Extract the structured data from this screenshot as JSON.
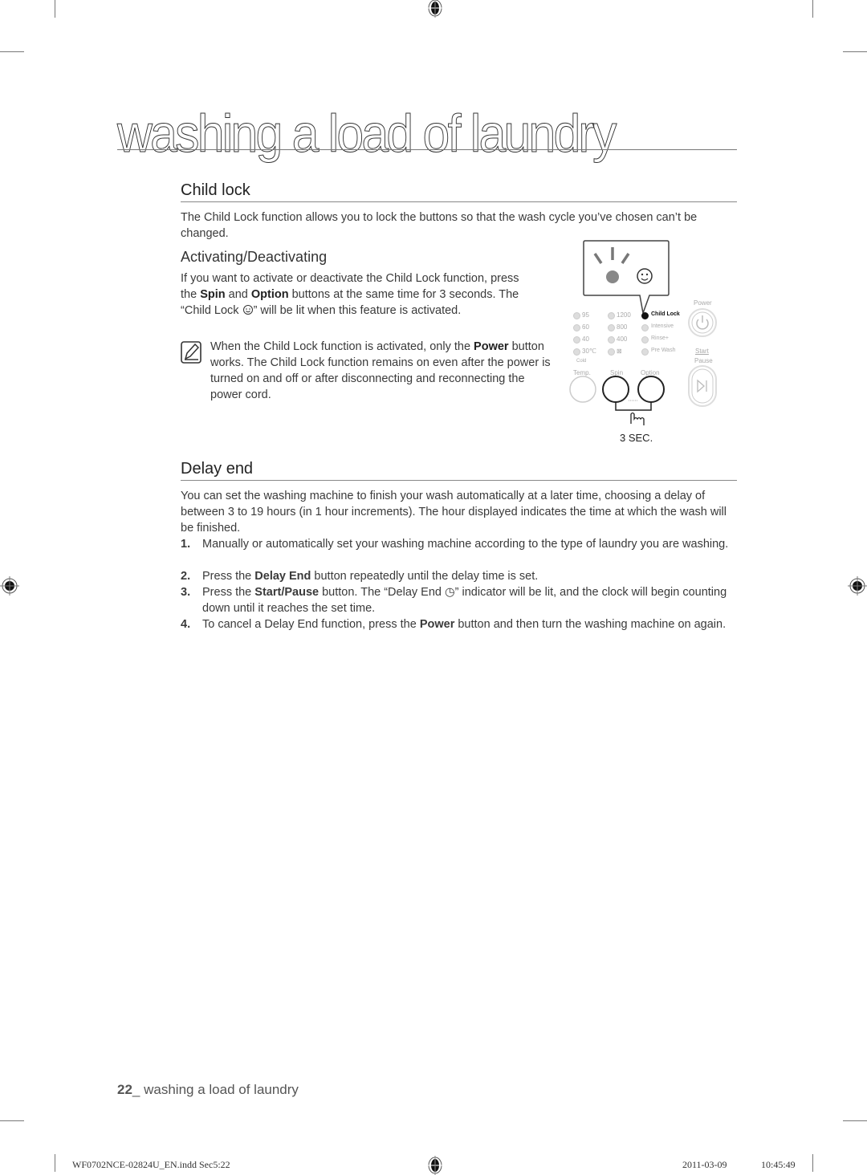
{
  "page": {
    "title": "washing a load of laundry",
    "footer": {
      "page_number": "22",
      "separator": "_",
      "section": "washing a load of laundry"
    },
    "slug": {
      "file": "WF0702NCE-02824U_EN.indd   Sec5:22",
      "date": "2011-03-09",
      "time": "10:45:49"
    }
  },
  "child_lock": {
    "heading": "Child lock",
    "intro": "The Child Lock function allows you to lock the buttons so that the wash cycle you’ve chosen can’t be changed.",
    "subheading": "Activating/Deactivating",
    "body": {
      "p1": "If you want to activate or deactivate the Child Lock function, press the ",
      "spin": "Spin",
      "and": " and ",
      "option": "Option",
      "p2": " buttons at the same time for 3 seconds. The “",
      "child_lock": "Child Lock",
      "p3": "” will be lit when this feature is activated."
    },
    "note": {
      "icon": "note-pencil-icon",
      "p1": "When the Child Lock function is activated, only the ",
      "power": "Power",
      "p2": " button works. The Child Lock function remains on even after the power is turned on and off or after disconnecting and reconnecting the power cord."
    },
    "panel": {
      "temps": [
        "95",
        "60",
        "40",
        "30℃"
      ],
      "cold": "Cold",
      "spins": [
        "1200",
        "800",
        "400",
        "⊠"
      ],
      "options": [
        "Child Lock",
        "Intensive",
        "Rinse+",
        "Pre Wash"
      ],
      "labels": {
        "temp": "Temp.",
        "spin": "Spin",
        "option": "Option",
        "power": "Power",
        "start": "Start",
        "pause": "Pause"
      },
      "hold_label": "3 SEC.",
      "lit_option": "Child Lock"
    }
  },
  "delay_end": {
    "heading": "Delay end",
    "intro": "You can set the washing machine to finish your wash automatically at a later time, choosing a delay of between 3 to 19 hours (in 1 hour increments). The hour displayed indicates the time at which the wash will be finished.",
    "steps": [
      {
        "num": "1.",
        "pre": "Manually or automatically set your washing machine according to the type of laundry you are washing.",
        "bold": "",
        "post": ""
      },
      {
        "num": "2.",
        "pre": "Press the ",
        "bold": "Delay End",
        "post": " button repeatedly until the delay time is set."
      },
      {
        "num": "3.",
        "pre": "Press the ",
        "bold": "Start/Pause",
        "post": " button. The “Delay End ◷” indicator will be lit, and the clock will begin counting down until it reaches the set time."
      },
      {
        "num": "4.",
        "pre": "To cancel a Delay End function, press the ",
        "bold": "Power",
        "post": " button and then turn the washing machine on again."
      }
    ]
  }
}
